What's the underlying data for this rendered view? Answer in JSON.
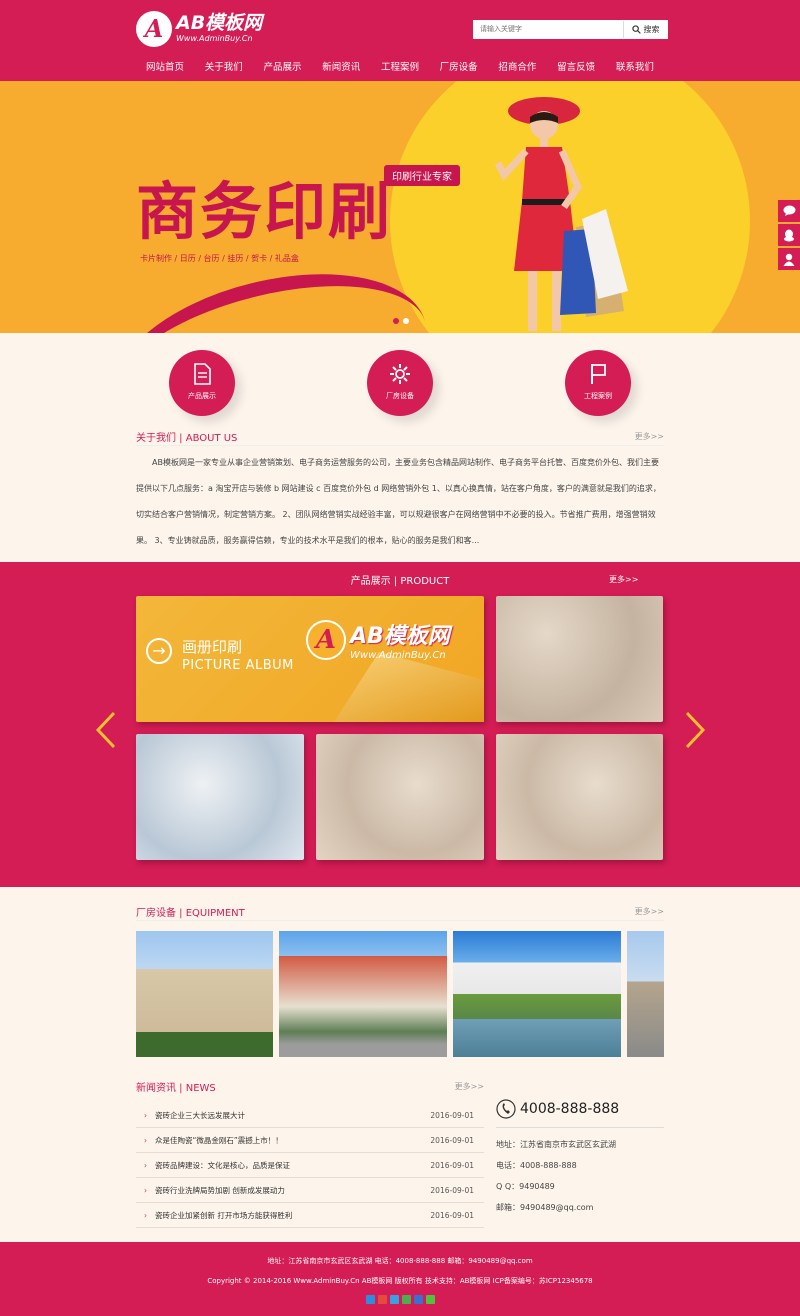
{
  "header": {
    "logo_main": "AB模板网",
    "logo_sub": "Www.AdminBuy.Cn",
    "search_placeholder": "请输入关键字",
    "search_button": "搜索"
  },
  "nav": [
    "网站首页",
    "关于我们",
    "产品展示",
    "新闻资讯",
    "工程案例",
    "厂房设备",
    "招商合作",
    "留言反馈",
    "联系我们"
  ],
  "banner": {
    "headline": "商务印刷",
    "tag": "印刷行业专家",
    "subline": "卡片制作 / 日历 / 台历 / 挂历 / 贺卡 / 礼品盒"
  },
  "icon_links": [
    {
      "label": "产品展示",
      "icon": "document-icon"
    },
    {
      "label": "厂房设备",
      "icon": "gear-icon"
    },
    {
      "label": "工程案例",
      "icon": "flag-icon"
    }
  ],
  "about": {
    "title": "关于我们 | ABOUT US",
    "more": "更多>>",
    "text": "AB模板网是一家专业从事企业营销策划、电子商务运营服务的公司，主要业务包含精品网站制作、电子商务平台托管、百度竞价外包、我们主要提供以下几点服务：a 淘宝开店与装修 b 网站建设 c 百度竞价外包 d 网络营销外包 1、以真心换真情，站在客户角度，客户的满意就是我们的追求，切实结合客户营销情况，制定营销方案。 2、团队网络营销实战经验丰富，可以规避很客户在网络营销中不必要的投入。节省推广费用，增强营销效果。 3、专业铸就品质，服务赢得信赖，专业的技术水平是我们的根本，贴心的服务是我们和客..."
  },
  "product": {
    "title": "产品展示 | PRODUCT",
    "more": "更多>>",
    "album_cn": "画册印刷",
    "album_en": "PICTURE ALBUM",
    "watermark_main": "AB模板网",
    "watermark_sub": "Www.AdminBuy.Cn"
  },
  "equipment": {
    "title": "厂房设备 | EQUIPMENT",
    "more": "更多>>"
  },
  "news": {
    "title": "新闻资讯 | NEWS",
    "more": "更多>>",
    "items": [
      {
        "title": "瓷砖企业三大长远发展大计",
        "date": "2016-09-01"
      },
      {
        "title": "众是佳陶瓷“微晶金刚石”震撼上市！！",
        "date": "2016-09-01"
      },
      {
        "title": "瓷砖品牌建设：文化是核心，品质是保证",
        "date": "2016-09-01"
      },
      {
        "title": "瓷砖行业洗牌局势加剧 创新成发展动力",
        "date": "2016-09-01"
      },
      {
        "title": "瓷砖企业加紧创新 打开市场方能获得胜利",
        "date": "2016-09-01"
      }
    ]
  },
  "contact": {
    "phone": "4008-888-888",
    "address": "地址：江苏省南京市玄武区玄武湖",
    "tel": "电话：4008-888-888",
    "qq": "Q Q：9490489",
    "email": "邮箱：9490489@qq.com"
  },
  "footer": {
    "line1": "地址：江苏省南京市玄武区玄武湖    电话：4008-888-888    邮箱：9490489@qq.com",
    "line2": "Copyright © 2014-2016 Www.AdminBuy.Cn AB模板网 版权所有    技术支持：AB模板网    ICP备案编号：苏ICP12345678"
  },
  "colors": {
    "primary": "#d41c55",
    "banner_orange": "#f7ac2f",
    "banner_yellow": "#fbd02a",
    "page_bg": "#fdf5ec"
  }
}
